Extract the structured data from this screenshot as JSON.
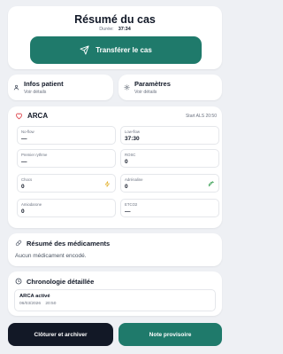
{
  "header": {
    "title": "Résumé du cas",
    "duration_label": "Durée:",
    "duration_value": "37:34",
    "transfer_label": "Transférer le cas"
  },
  "patient_card": {
    "title": "Infos patient",
    "subtitle": "Voir détails",
    "icon": "user-icon"
  },
  "params_card": {
    "title": "Paramètres",
    "subtitle": "Voir détails",
    "icon": "settings-icon"
  },
  "arca": {
    "title": "ARCA",
    "start": "Start ALS 20:50",
    "icon": "heart-icon",
    "fields": [
      {
        "label": "No-flow",
        "value": "—"
      },
      {
        "label": "Low-flow",
        "value": "37:30"
      },
      {
        "label": "Premier rythme",
        "value": "—"
      },
      {
        "label": "ROSC",
        "value": "0"
      },
      {
        "label": "Chocs",
        "value": "0",
        "action_icon": "lightning-icon"
      },
      {
        "label": "Adrénaline",
        "value": "0",
        "action_icon": "syringe-icon"
      },
      {
        "label": "Amiodarone",
        "value": "0"
      },
      {
        "label": "ETCO2",
        "value": "—"
      }
    ]
  },
  "meds": {
    "title": "Résumé des médicaments",
    "empty": "Aucun médicament encodé.",
    "icon": "pill-icon"
  },
  "chrono": {
    "title": "Chronologie détaillée",
    "icon": "clock-icon",
    "events": [
      {
        "title": "ARCA activé",
        "date": "06/03/2026",
        "time": "20:50"
      }
    ]
  },
  "footer": {
    "archive_label": "Clôturer et archiver",
    "note_label": "Note provisoire"
  },
  "colors": {
    "primary": "#1f7a6b",
    "dark": "#121826",
    "danger": "#e0555c",
    "warning": "#e3b02b",
    "success": "#2e9a4a"
  }
}
